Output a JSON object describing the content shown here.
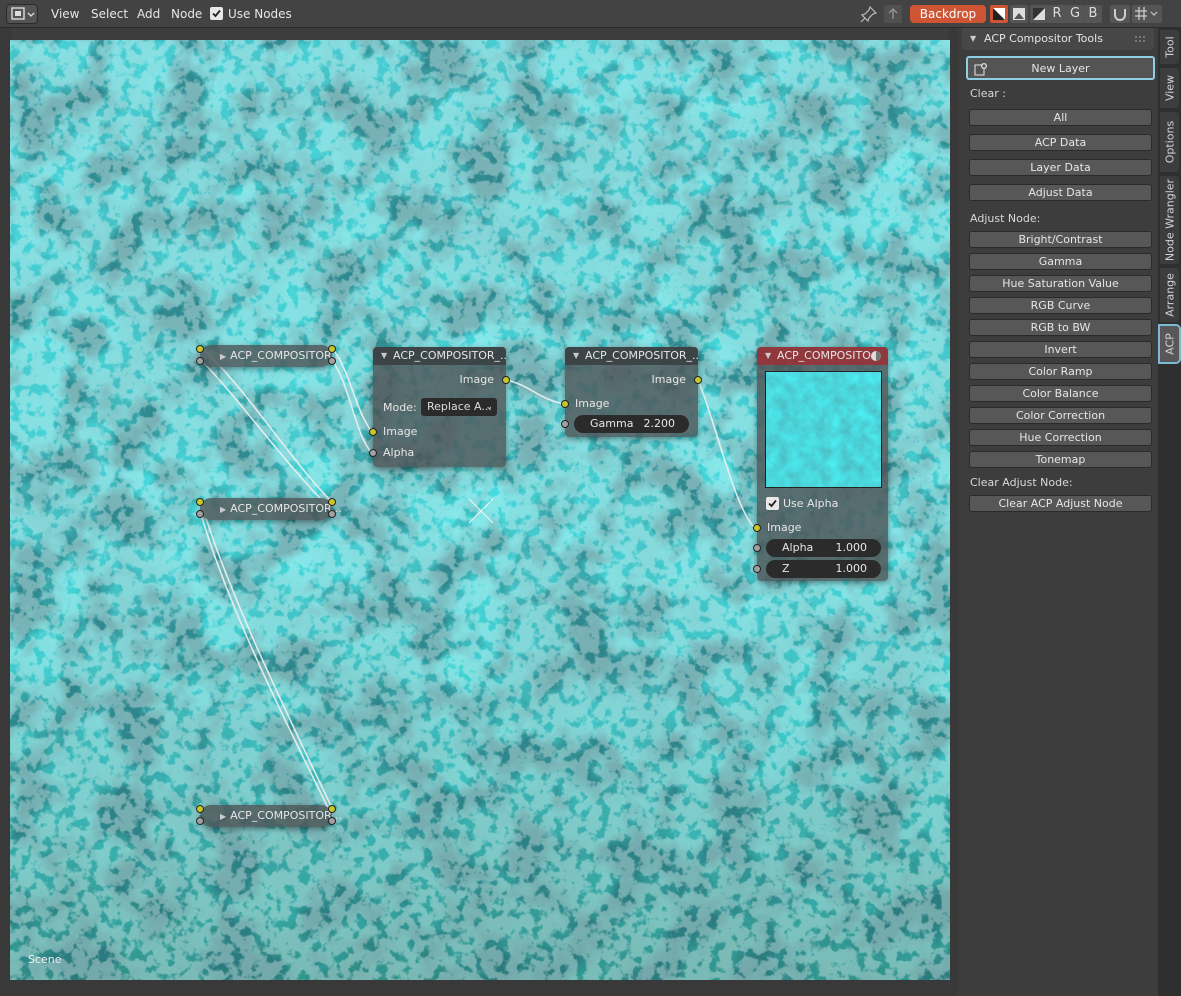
{
  "topbar": {
    "menus": [
      "View",
      "Select",
      "Add",
      "Node"
    ],
    "use_nodes_label": "Use Nodes",
    "use_nodes_checked": true,
    "backdrop_label": "Backdrop",
    "channel_buttons": [
      "R",
      "G",
      "B"
    ],
    "accent": "#cd5533"
  },
  "nodes": {
    "layer1_title": "ACP_COMPOSITOR...",
    "layer2_title": "ACP_COMPOSITOR...",
    "layer3_title": "ACP_COMPOSITOR...",
    "mix": {
      "title": "ACP_COMPOSITOR_...",
      "out_image": "Image",
      "mode_label": "Mode:",
      "mode_value": "Replace A...",
      "in_image": "Image",
      "in_alpha": "Alpha"
    },
    "gamma": {
      "title": "ACP_COMPOSITOR_...",
      "out_image": "Image",
      "in_image": "Image",
      "gamma_label": "Gamma",
      "gamma_value": "2.200"
    },
    "composite": {
      "title": "ACP_COMPOSITO...",
      "use_alpha_label": "Use Alpha",
      "use_alpha_checked": true,
      "in_image": "Image",
      "alpha_label": "Alpha",
      "alpha_value": "1.000",
      "z_label": "Z",
      "z_value": "1.000"
    }
  },
  "scene_label": "Scene",
  "sidebar": {
    "panel_title": "ACP Compositor Tools",
    "new_layer": "New Layer",
    "clear_label": "Clear :",
    "clear_buttons": [
      "All",
      "ACP Data",
      "Layer Data",
      "Adjust Data"
    ],
    "adjust_label": "Adjust Node:",
    "adjust_buttons": [
      "Bright/Contrast",
      "Gamma",
      "Hue Saturation Value",
      "RGB Curve",
      "RGB to BW",
      "Invert",
      "Color Ramp",
      "Color Balance",
      "Color Correction",
      "Hue Correction",
      "Tonemap"
    ],
    "clear_adjust_label": "Clear Adjust Node:",
    "clear_adjust_button": "Clear ACP Adjust Node"
  },
  "tabs": [
    "Tool",
    "View",
    "Options",
    "Node Wrangler",
    "Arrange",
    "ACP"
  ],
  "active_tab": "ACP"
}
